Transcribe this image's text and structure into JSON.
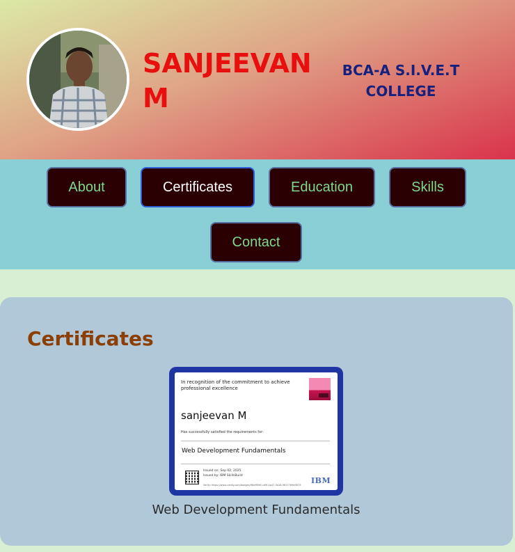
{
  "header": {
    "name": "SANJEEVAN M",
    "college": "BCA-A S.I.V.E.T COLLEGE"
  },
  "nav": {
    "items": [
      {
        "label": "About",
        "active": false
      },
      {
        "label": "Certificates",
        "active": true
      },
      {
        "label": "Education",
        "active": false
      },
      {
        "label": "Skills",
        "active": false
      },
      {
        "label": "Contact",
        "active": false
      }
    ]
  },
  "certificates": {
    "title": "Certificates",
    "items": [
      {
        "recognition": "In recognition of the commitment to achieve professional excellence",
        "recipient": "sanjeevan M",
        "requirement": "Has successfully satisfied the requirements for:",
        "course": "Web Development Fundamentals",
        "issued_on": "Issued on: Sep 02, 2025",
        "issued_by": "Issued by: IBM SkillsBuild",
        "verify": "Verify: https://www.credly.com/badges/98dff596-cd9f-4a47-9a28-9817789d9879",
        "issuer_logo": "IBM",
        "caption": "Web Development Fundamentals"
      }
    ]
  },
  "colors": {
    "name": "#e8100f",
    "college": "#16207d",
    "nav_bg": "#89cfd5",
    "nav_button": "#2b0003",
    "nav_text": "#7fd98a",
    "panel": "#b0c8d8",
    "section_title": "#8b3f05",
    "cert_frame": "#1f35a4"
  }
}
